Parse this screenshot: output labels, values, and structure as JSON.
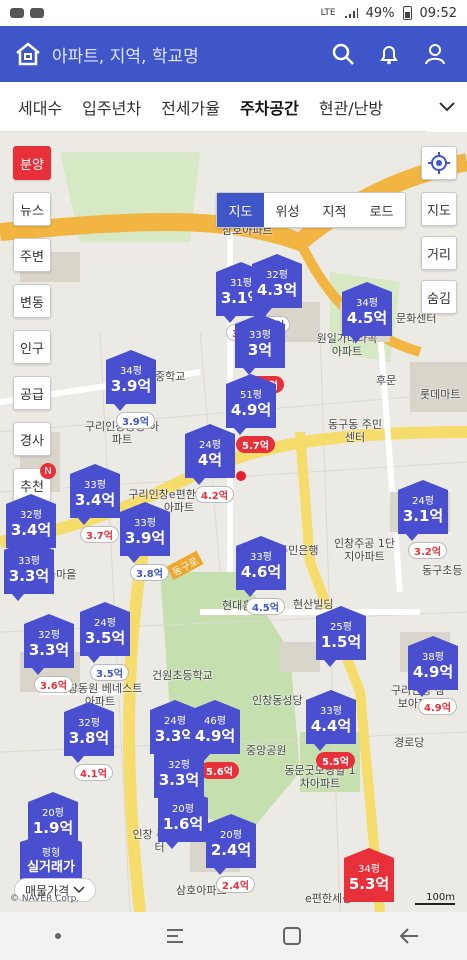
{
  "status_bar": {
    "time": "09:52",
    "battery": "49%",
    "network": "LTE"
  },
  "header": {
    "search_placeholder": "아파트, 지역, 학교명"
  },
  "tabs": [
    {
      "label": "세대수"
    },
    {
      "label": "입주년차"
    },
    {
      "label": "전세가율"
    },
    {
      "label": "주차공간",
      "active": true
    },
    {
      "label": "현관/난방"
    }
  ],
  "side_menu": [
    "분양",
    "뉴스",
    "주변",
    "변동",
    "인구",
    "공급",
    "경사",
    "추천"
  ],
  "side_badge": "N",
  "map_type": [
    "지도",
    "위성",
    "지적",
    "로드"
  ],
  "right_buttons": [
    "지도",
    "거리",
    "숨김"
  ],
  "markers": [
    {
      "py": "31평",
      "price": "3.1억",
      "sub": "3.1억",
      "sub_style": "redtxt"
    },
    {
      "py": "32평",
      "price": "4.3억",
      "sub": "4억",
      "sub_style": ""
    },
    {
      "py": "34평",
      "price": "4.5억",
      "sub": "",
      "sub_style": ""
    },
    {
      "py": "33평",
      "price": "3억",
      "sub": "3.4억",
      "sub_style": "red"
    },
    {
      "py": "34평",
      "price": "3.9억",
      "sub": "3.9억",
      "sub_style": ""
    },
    {
      "py": "51평",
      "price": "4.9억",
      "sub": "5.7억",
      "sub_style": "red"
    },
    {
      "py": "24평",
      "price": "4억",
      "sub": "4.2억",
      "sub_style": "redtxt"
    },
    {
      "py": "33평",
      "price": "3.4억",
      "sub": "3.7억",
      "sub_style": "redtxt"
    },
    {
      "py": "33평",
      "price": "3.9억",
      "sub": "3.8억",
      "sub_style": ""
    },
    {
      "py": "32평",
      "price": "3.4억",
      "sub": "",
      "sub_style": ""
    },
    {
      "py": "33평",
      "price": "3.3억",
      "sub": "",
      "sub_style": ""
    },
    {
      "py": "24평",
      "price": "3.1억",
      "sub": "3.2억",
      "sub_style": "redtxt"
    },
    {
      "py": "33평",
      "price": "4.6억",
      "sub": "4.5억",
      "sub_style": ""
    },
    {
      "py": "32평",
      "price": "3.3억",
      "sub": "3.6억",
      "sub_style": "redtxt"
    },
    {
      "py": "24평",
      "price": "3.5억",
      "sub": "3.5억",
      "sub_style": ""
    },
    {
      "py": "25평",
      "price": "1.5억",
      "sub": "",
      "sub_style": ""
    },
    {
      "py": "38평",
      "price": "4.9억",
      "sub": "4.9억",
      "sub_style": "redtxt"
    },
    {
      "py": "32평",
      "price": "3.8억",
      "sub": "4.1억",
      "sub_style": "redtxt"
    },
    {
      "py": "24평",
      "price": "3.3억",
      "sub": "",
      "sub_style": ""
    },
    {
      "py": "46평",
      "price": "4.9억",
      "sub": "5.6억",
      "sub_style": "red"
    },
    {
      "py": "33평",
      "price": "4.4억",
      "sub": "5.5억",
      "sub_style": "red"
    },
    {
      "py": "32평",
      "price": "3.3억",
      "sub": "",
      "sub_style": ""
    },
    {
      "py": "20평",
      "price": "1.9억",
      "sub": "",
      "sub_style": ""
    },
    {
      "py": "20평",
      "price": "1.6억",
      "sub": "",
      "sub_style": ""
    },
    {
      "py": "20평",
      "price": "2.4억",
      "sub": "2.4억",
      "sub_style": "redtxt"
    },
    {
      "py": "평형",
      "price": "실거래가",
      "sub": "",
      "sub_style": ""
    },
    {
      "py": "34평",
      "price": "5.3억",
      "sub": "",
      "sub_style": ""
    }
  ],
  "place_labels": [
    "삼호아파트",
    "원일가대라곡 아파트",
    "문화센터",
    "중학교",
    "구리인창동양 아파트",
    "동구동 주민센터",
    "구리인창e편한세상 차아파트",
    "인창주공 1단지아파트",
    "주민은행",
    "동구초등",
    "현대홈타운",
    "현산빌딩",
    "건원초등학교",
    "인창동원 베네스트아파트",
    "인창동성당",
    "동문굿모닝힐 1차아파트",
    "구리인창 삼보아파트",
    "경로당",
    "중앙공원",
    "인창 주민센터",
    "삼호아파트",
    "e편한세상",
    "롯데마트",
    "후문",
    "틀마을"
  ],
  "road_label": "동구로",
  "bottom_chip": "매물가격",
  "scale_label": "100m",
  "copyright": "© NAVER Corp.",
  "colors": {
    "brand": "#3f56c8",
    "marker": "#4a4fd0",
    "alert": "#e8303a"
  }
}
